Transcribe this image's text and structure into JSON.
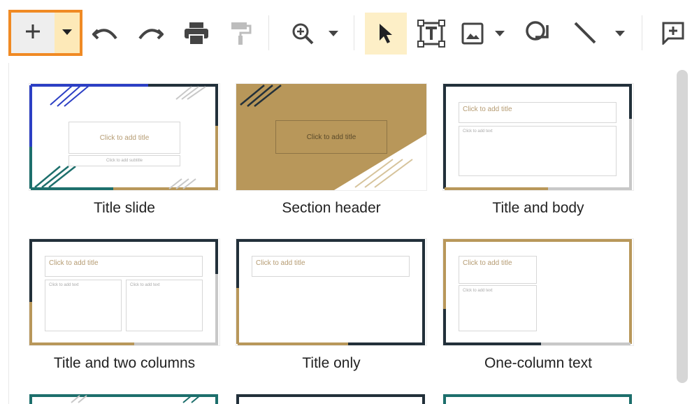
{
  "toolbar": {
    "icons": [
      "plus-icon",
      "chevron-down-icon",
      "undo-icon",
      "redo-icon",
      "print-icon",
      "paint-format-icon",
      "zoom-icon",
      "chevron-down-icon",
      "cursor-icon",
      "text-box-icon",
      "image-icon",
      "shape-icon",
      "line-icon",
      "comment-icon"
    ],
    "highlight_color": "#f08a24"
  },
  "layouts": [
    {
      "label": "Title slide",
      "title_placeholder": "Click to add title",
      "subtitle_placeholder": "Click to add subtitle"
    },
    {
      "label": "Section header",
      "title_placeholder": "Click to add title"
    },
    {
      "label": "Title and body",
      "title_placeholder": "Click to add title",
      "body_placeholder": "Click to add text"
    },
    {
      "label": "Title and two columns",
      "title_placeholder": "Click to add title",
      "body_placeholder": "Click to add text"
    },
    {
      "label": "Title only",
      "title_placeholder": "Click to add title"
    },
    {
      "label": "One-column text",
      "title_placeholder": "Click to add title",
      "body_placeholder": "Click to add text"
    }
  ],
  "colors": {
    "gold": "#b8975a",
    "navy": "#22303a",
    "teal": "#1d6f6c",
    "blue": "#2c3fc4",
    "grey": "#c8c8c8"
  }
}
